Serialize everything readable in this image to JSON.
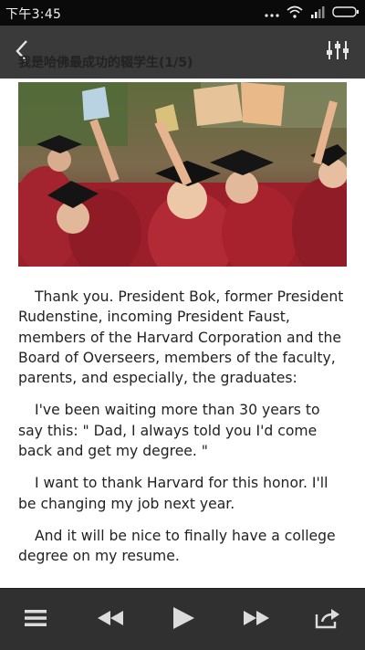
{
  "status_bar": {
    "time": "下午3:45"
  },
  "header": {
    "title": "我是哈佛最成功的辍学生(1/5)"
  },
  "article": {
    "paragraphs": [
      "Thank you.  President Bok,  former President Rudenstine,  incoming President Faust,  members of the Harvard Corporation and the Board of Overseers,  members of the faculty,  parents,  and especially,  the graduates:",
      "I've been waiting more than 30 years to say this: \" Dad,  I always told you I'd come back and get my degree. \"",
      "I want to thank Harvard for this honor.  I'll be changing my job next year.",
      "And it will be nice to finally have a college degree on my resume."
    ]
  },
  "player": {
    "buttons": [
      "menu-icon",
      "rewind-icon",
      "play-icon",
      "fast-forward-icon",
      "share-icon"
    ]
  },
  "colors": {
    "title_bar": "#3a3a3a",
    "player_bar": "#303030",
    "status_bar": "#0a0a0a",
    "icon": "#dcdcdc"
  }
}
